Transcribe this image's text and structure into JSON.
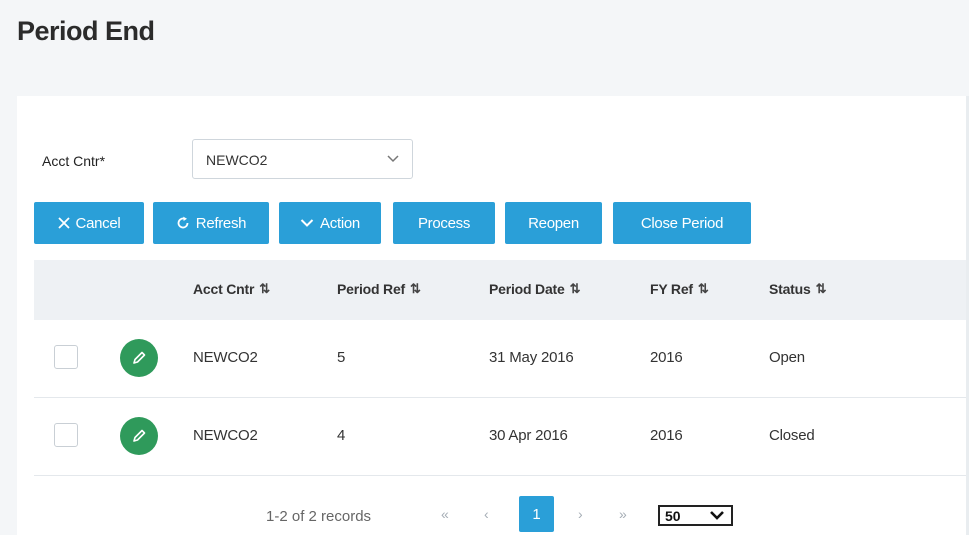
{
  "page": {
    "title": "Period End"
  },
  "filter": {
    "label": "Acct Cntr*",
    "value": "NEWCO2"
  },
  "toolbar": {
    "cancel": "Cancel",
    "refresh": "Refresh",
    "action": "Action",
    "process": "Process",
    "reopen": "Reopen",
    "close_period": "Close Period"
  },
  "table": {
    "columns": [
      "Acct Cntr",
      "Period Ref",
      "Period Date",
      "FY Ref",
      "Status"
    ],
    "sort_glyph": "⇅",
    "rows": [
      {
        "acct_cntr": "NEWCO2",
        "period_ref": "5",
        "period_date": "31 May 2016",
        "fy_ref": "2016",
        "status": "Open"
      },
      {
        "acct_cntr": "NEWCO2",
        "period_ref": "4",
        "period_date": "30 Apr 2016",
        "fy_ref": "2016",
        "status": "Closed"
      }
    ]
  },
  "pager": {
    "info": "1-2 of 2 records",
    "first": "«",
    "prev": "‹",
    "current": "1",
    "next": "›",
    "last": "»",
    "page_size": "50"
  },
  "colors": {
    "accent": "#2a9fd8",
    "edit_green": "#2f9a5b",
    "header_bg": "#eef1f4"
  },
  "icons": [
    "close-icon",
    "refresh-icon",
    "chevron-down-icon",
    "pencil-icon",
    "sort-icon"
  ]
}
